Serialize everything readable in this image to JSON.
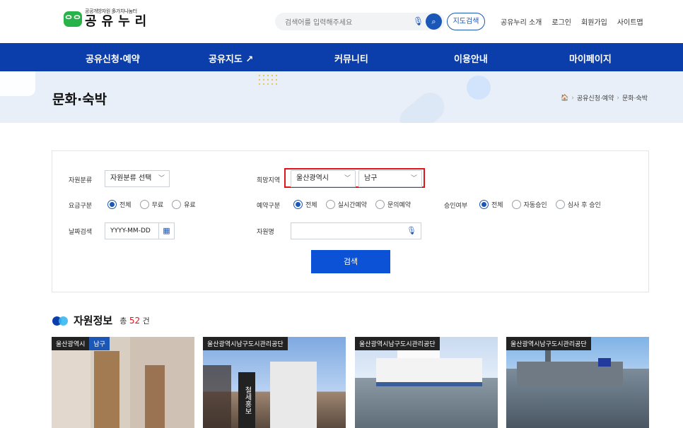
{
  "header": {
    "logo_sub": "공공개방자원 多가치나눔터",
    "logo_name": "공유누리",
    "search_placeholder": "검색어를 입력해주세요",
    "map_search_label": "지도검색",
    "util_links": [
      "공유누리 소개",
      "로그인",
      "회원가입",
      "사이트맵"
    ]
  },
  "gnb": {
    "items": [
      "공유신청·예약",
      "공유지도 ↗",
      "커뮤니티",
      "이용안내",
      "마이페이지"
    ]
  },
  "banner": {
    "title": "문화·숙박",
    "breadcrumb": [
      "공유신청·예약",
      "문화·숙박"
    ]
  },
  "filters": {
    "category_label": "자원분류",
    "category_value": "자원분류 선택",
    "region_label": "희망지역",
    "region_city": "울산광역시",
    "region_district": "남구",
    "fee_label": "요금구분",
    "fee_options": [
      "전체",
      "무료",
      "유료"
    ],
    "fee_selected": "전체",
    "reserve_label": "예약구분",
    "reserve_options": [
      "전체",
      "실시간예약",
      "문의예약"
    ],
    "reserve_selected": "전체",
    "approve_label": "승인여부",
    "approve_options": [
      "전체",
      "자동승인",
      "심사 후 승인"
    ],
    "approve_selected": "전체",
    "date_label": "날짜검색",
    "date_placeholder": "YYYY-MM-DD",
    "name_label": "자원명",
    "name_value": "",
    "search_button": "검색"
  },
  "results": {
    "title": "자원정보",
    "total_prefix": "총",
    "total_count": "52",
    "total_suffix": "건",
    "cards": [
      {
        "tags": [
          "울산광역시",
          "남구"
        ]
      },
      {
        "tags": [
          "울산광역시남구도시관리공단"
        ]
      },
      {
        "tags": [
          "울산광역시남구도시관리공단"
        ]
      },
      {
        "tags": [
          "울산광역시남구도시관리공단"
        ]
      }
    ],
    "card2_sign": "철세홍보"
  },
  "colors": {
    "brand_blue": "#0b3eaa",
    "button_blue": "#0b52d6",
    "highlight_red": "#e0141a",
    "logo_green": "#27b34a"
  }
}
